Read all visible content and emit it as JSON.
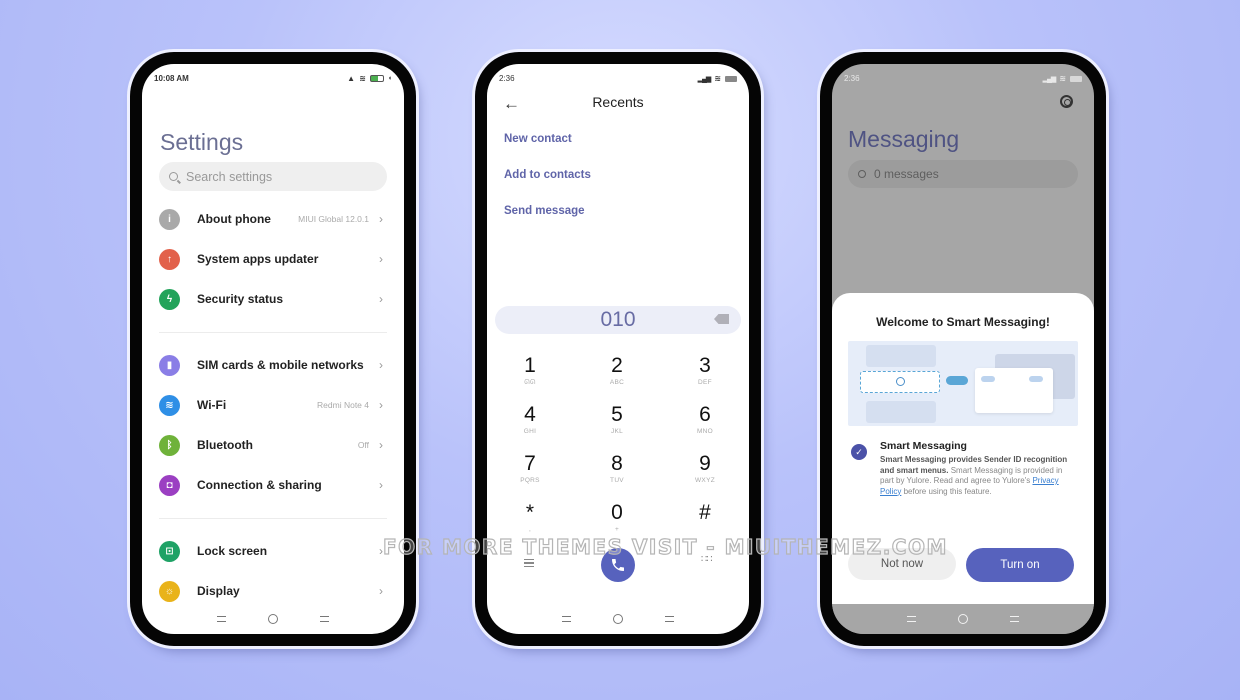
{
  "watermark": "FOR MORE THEMES VISIT - MIUITHEMEZ.COM",
  "settings_phone": {
    "status_time": "10:08 AM",
    "title": "Settings",
    "search_placeholder": "Search settings",
    "groups": [
      [
        {
          "label": "About phone",
          "value": "MIUI Global 12.0.1",
          "icon": "info-icon",
          "color": "#a9a9a9",
          "glyph": "i"
        },
        {
          "label": "System apps updater",
          "value": "",
          "icon": "cloud-upload-icon",
          "color": "#e2614b",
          "glyph": "↑"
        },
        {
          "label": "Security status",
          "value": "",
          "icon": "shield-icon",
          "color": "#22a35a",
          "glyph": "ϟ"
        }
      ],
      [
        {
          "label": "SIM cards & mobile networks",
          "value": "",
          "icon": "sim-card-icon",
          "color": "#8a7ee6",
          "glyph": "▮"
        },
        {
          "label": "Wi-Fi",
          "value": "Redmi Note 4",
          "icon": "wifi-icon",
          "color": "#2f8fe6",
          "glyph": "≋"
        },
        {
          "label": "Bluetooth",
          "value": "Off",
          "icon": "bluetooth-icon",
          "color": "#6fb23a",
          "glyph": "ᛒ"
        },
        {
          "label": "Connection & sharing",
          "value": "",
          "icon": "connection-icon",
          "color": "#9b3fc2",
          "glyph": "◘"
        }
      ],
      [
        {
          "label": "Lock screen",
          "value": "",
          "icon": "lock-icon",
          "color": "#1fa266",
          "glyph": "⊡"
        },
        {
          "label": "Display",
          "value": "",
          "icon": "display-icon",
          "color": "#e9b31a",
          "glyph": "☼"
        }
      ]
    ]
  },
  "dialer_phone": {
    "status_time": "2:36",
    "title": "Recents",
    "links": [
      "New contact",
      "Add to contacts",
      "Send message"
    ],
    "number": "010",
    "keys": [
      {
        "d": "1",
        "l": "ᘏᘏ"
      },
      {
        "d": "2",
        "l": "ABC"
      },
      {
        "d": "3",
        "l": "DEF"
      },
      {
        "d": "4",
        "l": "GHI"
      },
      {
        "d": "5",
        "l": "JKL"
      },
      {
        "d": "6",
        "l": "MNO"
      },
      {
        "d": "7",
        "l": "PQRS"
      },
      {
        "d": "8",
        "l": "TUV"
      },
      {
        "d": "9",
        "l": "WXYZ"
      },
      {
        "d": "*",
        "l": ","
      },
      {
        "d": "0",
        "l": "+"
      },
      {
        "d": "#",
        "l": ""
      }
    ]
  },
  "messaging_phone": {
    "status_time": "2:36",
    "title": "Messaging",
    "search_placeholder": "0 messages",
    "dialog": {
      "title": "Welcome to Smart Messaging!",
      "option_title": "Smart Messaging",
      "option_checked": true,
      "desc_bold": "Smart Messaging provides Sender ID recognition and smart menus.",
      "desc_text": " Smart Messaging is provided in part by Yulore. Read and agree to Yulore's ",
      "desc_link": "Privacy Policy",
      "desc_end": " before using this feature.",
      "btn_secondary": "Not now",
      "btn_primary": "Turn on"
    }
  }
}
